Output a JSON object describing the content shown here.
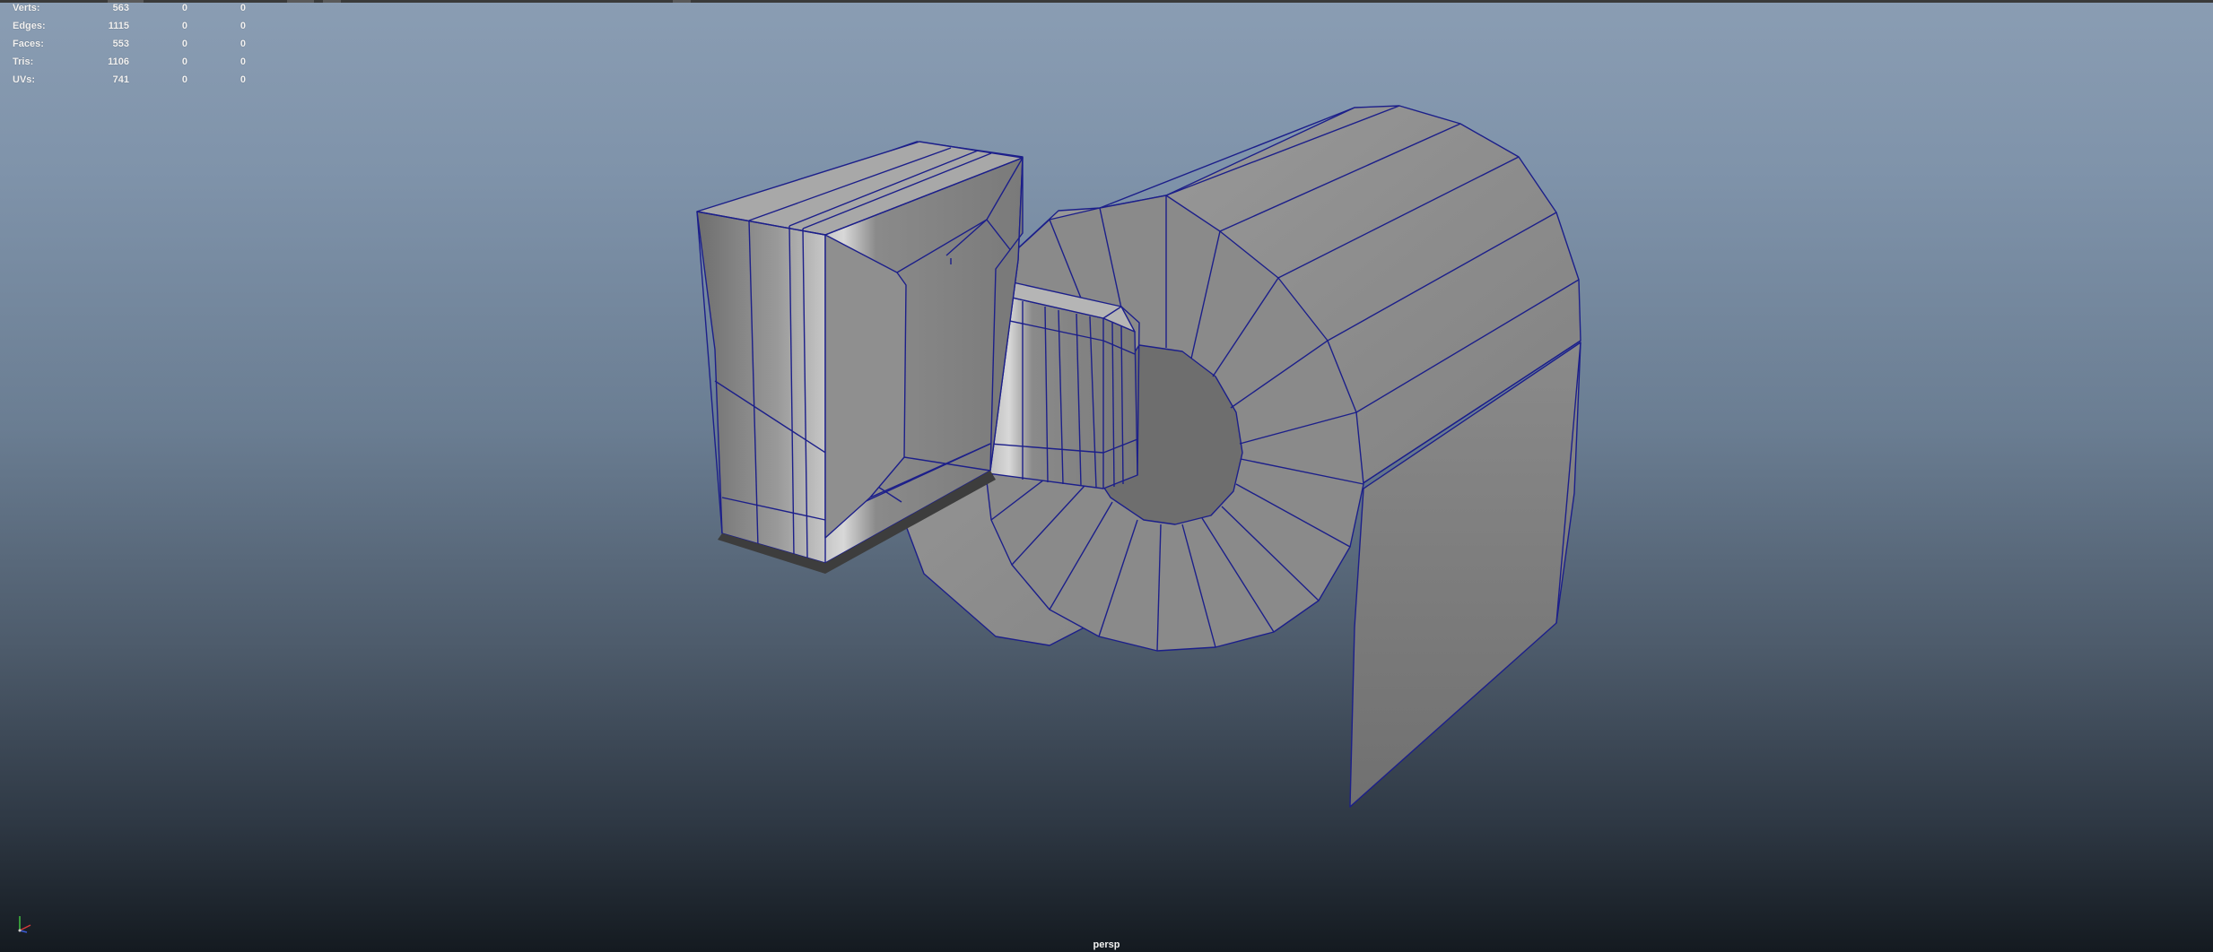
{
  "hud": {
    "rows": [
      {
        "label": "Verts:",
        "v1": "563",
        "v2": "0",
        "v3": "0"
      },
      {
        "label": "Edges:",
        "v1": "1115",
        "v2": "0",
        "v3": "0"
      },
      {
        "label": "Faces:",
        "v1": "553",
        "v2": "0",
        "v3": "0"
      },
      {
        "label": "Tris:",
        "v1": "1106",
        "v2": "0",
        "v3": "0"
      },
      {
        "label": "UVs:",
        "v1": "741",
        "v2": "0",
        "v3": "0"
      }
    ]
  },
  "viewport": {
    "camera": "persp",
    "wire_color": "#1c1f8a",
    "face_color": "#8c8c8c",
    "background_top": "#8a9db3",
    "background_bottom": "#141a20"
  },
  "axis_gizmo": {
    "x": "#d23a3a",
    "y": "#3fbf3f",
    "z": "#3b5bd6"
  }
}
